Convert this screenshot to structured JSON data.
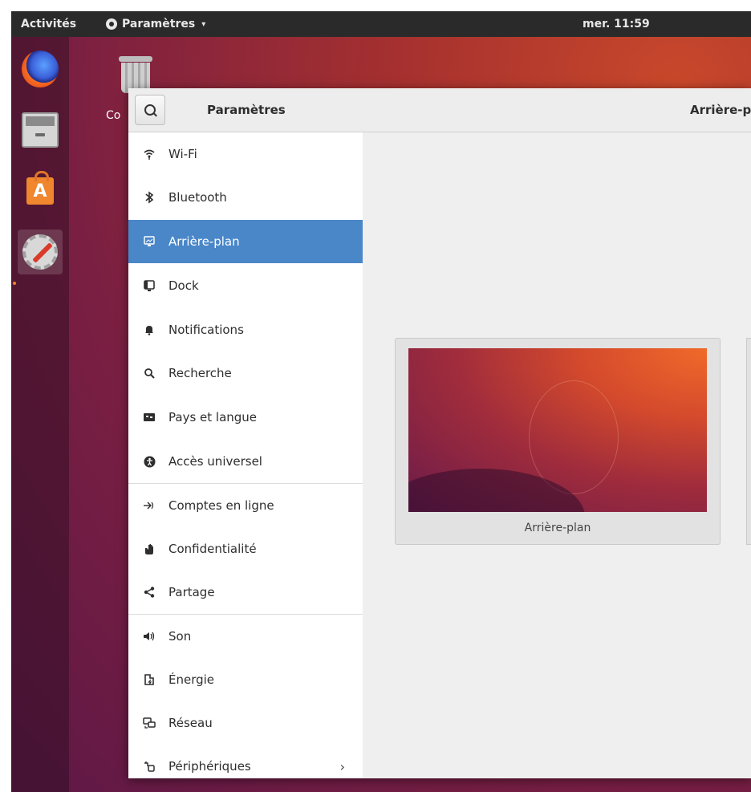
{
  "topbar": {
    "activities": "Activités",
    "app_menu": "Paramètres",
    "clock": "mer. 11:59"
  },
  "dock": {
    "items": [
      "firefox-icon",
      "files-icon",
      "software-icon",
      "settings-icon"
    ],
    "bottom": "···"
  },
  "desktop": {
    "trash_label": "Co"
  },
  "window": {
    "sidebar_title": "Paramètres",
    "main_title": "Arrière-p"
  },
  "sidebar": {
    "items": [
      {
        "label": "Wi-Fi",
        "icon": "wifi-icon"
      },
      {
        "label": "Bluetooth",
        "icon": "bluetooth-icon"
      },
      {
        "label": "Arrière-plan",
        "icon": "background-icon",
        "selected": true
      },
      {
        "label": "Dock",
        "icon": "dock-icon"
      },
      {
        "label": "Notifications",
        "icon": "bell-icon"
      },
      {
        "label": "Recherche",
        "icon": "search-icon"
      },
      {
        "label": "Pays et langue",
        "icon": "flag-icon"
      },
      {
        "label": "Accès universel",
        "icon": "accessibility-icon"
      },
      {
        "label": "Comptes en ligne",
        "icon": "online-accounts-icon"
      },
      {
        "label": "Confidentialité",
        "icon": "hand-icon"
      },
      {
        "label": "Partage",
        "icon": "share-icon"
      },
      {
        "label": "Son",
        "icon": "speaker-icon"
      },
      {
        "label": "Énergie",
        "icon": "battery-icon"
      },
      {
        "label": "Réseau",
        "icon": "network-icon"
      },
      {
        "label": "Périphériques",
        "icon": "devices-icon"
      }
    ]
  },
  "main": {
    "wallpaper_label": "Arrière-plan"
  },
  "colors": {
    "selected": "#4a87c9",
    "topbar": "#2a2a2a"
  }
}
